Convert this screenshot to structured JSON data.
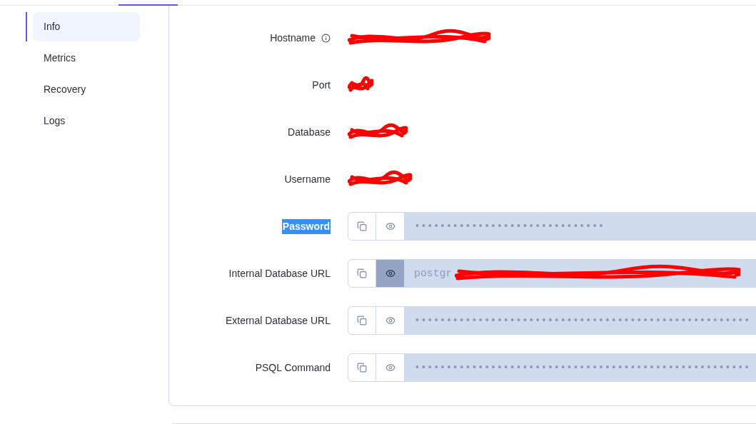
{
  "sidebar": {
    "items": [
      {
        "label": "Info",
        "selected": true
      },
      {
        "label": "Metrics",
        "selected": false
      },
      {
        "label": "Recovery",
        "selected": false
      },
      {
        "label": "Logs",
        "selected": false
      }
    ]
  },
  "fields": [
    {
      "kind": "plain",
      "label": "Hostname",
      "info": true,
      "redacted": true
    },
    {
      "kind": "plain",
      "label": "Port",
      "info": false,
      "redacted": true
    },
    {
      "kind": "plain",
      "label": "Database",
      "info": false,
      "redacted": true
    },
    {
      "kind": "plain",
      "label": "Username",
      "info": false,
      "redacted": true
    },
    {
      "kind": "secret",
      "label": "Password",
      "highlighted": true,
      "revealed": false,
      "value": "••••••••••••••••••••••••••••••"
    },
    {
      "kind": "secret",
      "label": "Internal Database URL",
      "highlighted": false,
      "revealed": true,
      "value": "postgr",
      "redacted": true
    },
    {
      "kind": "secret",
      "label": "External Database URL",
      "highlighted": false,
      "revealed": false,
      "value": "•••••••••••••••••••••••••••••••••••••••••••••••••••••"
    },
    {
      "kind": "secret",
      "label": "PSQL Command",
      "highlighted": false,
      "revealed": false,
      "value": "•••••••••••••••••••••••••••••••••••••••••••••••••••••"
    }
  ]
}
